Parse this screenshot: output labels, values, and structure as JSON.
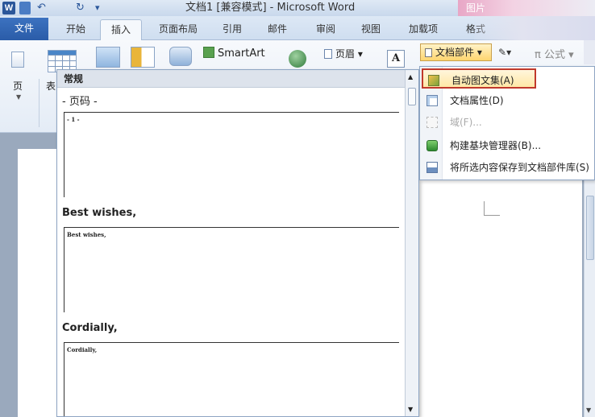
{
  "window": {
    "title": "文档1 [兼容模式] - Microsoft Word",
    "qa_word": "W",
    "qa_undo": "↶",
    "qa_redo": "↻",
    "qa_custom": "▾",
    "tools_label": "图片"
  },
  "tabs": [
    {
      "label": "文件"
    },
    {
      "label": "开始"
    },
    {
      "label": "插入"
    },
    {
      "label": "页面布局"
    },
    {
      "label": "引用"
    },
    {
      "label": "邮件"
    },
    {
      "label": "审阅"
    },
    {
      "label": "视图"
    },
    {
      "label": "加载项"
    },
    {
      "label": "格式"
    }
  ],
  "ribbon": {
    "page_label": "页",
    "table_label": "表",
    "smartart_label": "SmartArt",
    "header_label": "页眉 ▾",
    "textbox_label": "A",
    "quickparts_label": "文档部件 ▾",
    "signature_label": "▾",
    "formula_label": "π 公式 ▾"
  },
  "gallery": {
    "header": "常规",
    "entries": [
      {
        "title": "- 页码 -",
        "preview": "- 1 -"
      },
      {
        "title": "Best wishes,",
        "preview": "Best wishes,"
      },
      {
        "title": "Cordially,",
        "preview": "Cordially,"
      }
    ]
  },
  "quickparts_menu": {
    "items": [
      {
        "label": "自动图文集(A)",
        "icon": "autotext-icon",
        "highlighted": true
      },
      {
        "label": "文档属性(D)",
        "icon": "document-properties-icon"
      },
      {
        "label": "域(F)...",
        "icon": "field-icon",
        "disabled": true
      },
      {
        "label": "构建基块管理器(B)...",
        "icon": "building-blocks-organizer-icon"
      },
      {
        "label": "将所选内容保存到文档部件库(S)",
        "icon": "save-selection-icon"
      }
    ]
  }
}
